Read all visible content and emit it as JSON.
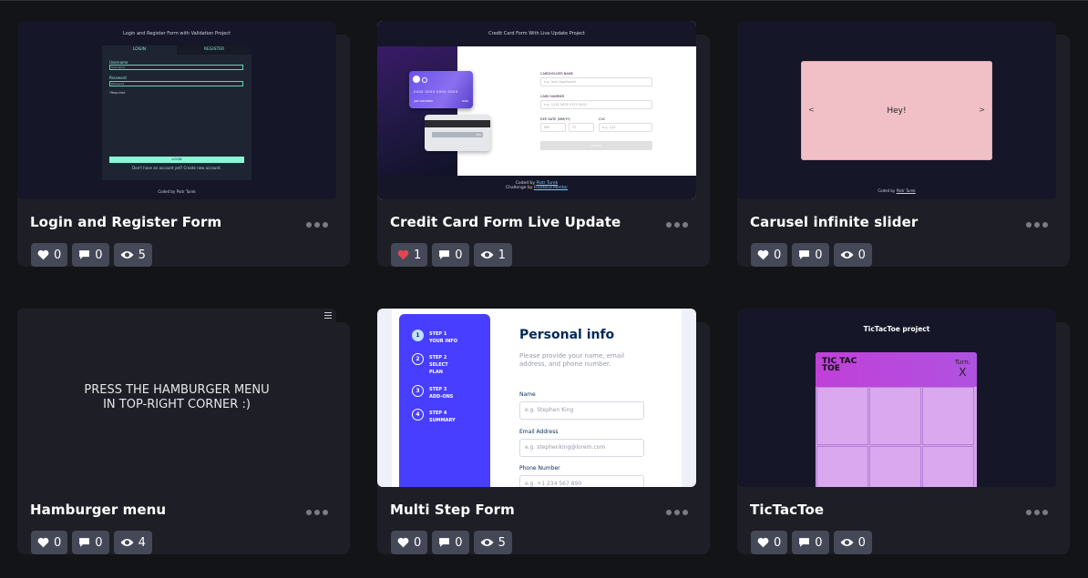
{
  "cards": [
    {
      "title": "Login and Register Form",
      "likes": "0",
      "comments": "0",
      "views": "5",
      "liked": false,
      "preview": {
        "heading": "Login and Register Form with Validation Project",
        "tab_login": "LOGIN",
        "tab_register": "REGISTER",
        "username_label": "Username",
        "username_placeholder": "Username",
        "password_label": "Password",
        "password_placeholder": "Password",
        "required": "*Required",
        "login_button": "LOGIN",
        "footer": "Don't have an account yet? Create new account.",
        "coded_by": "Coded by Piotr Turek"
      }
    },
    {
      "title": "Credit Card Form Live Update",
      "likes": "1",
      "comments": "0",
      "views": "1",
      "liked": true,
      "preview": {
        "heading": "Credit Card Form With Live Update Project",
        "card_number": "0000 0000 0000 0000",
        "card_name": "JANE APPLESEED",
        "card_exp": "00/00",
        "card_cvc": "000",
        "name_label": "CARDHOLDER NAME",
        "name_placeholder": "e.g. Jane Appleseed",
        "number_label": "CARD NUMBER",
        "number_placeholder": "e.g. 1234 5678 9123 0000",
        "exp_label": "EXP. DATE (MM/YY)",
        "mm_placeholder": "MM",
        "yy_placeholder": "YY",
        "cvc_label": "CVC",
        "cvc_placeholder": "e.g. 123",
        "confirm": "Confirm",
        "coded_prefix": "Coded by ",
        "coded_name": "Piotr Turek",
        "challenge_prefix": "Challenge by ",
        "challenge_name": "Frontend Mentor"
      }
    },
    {
      "title": "Carusel infinite slider",
      "likes": "0",
      "comments": "0",
      "views": "0",
      "liked": false,
      "preview": {
        "slide_text": "Hey!",
        "prev": "<",
        "next": ">",
        "coded_prefix": "Coded by ",
        "coded_name": "Piotr Turek"
      }
    },
    {
      "title": "Hamburger menu",
      "likes": "0",
      "comments": "0",
      "views": "4",
      "liked": false,
      "preview": {
        "line1": "PRESS THE HAMBURGER MENU",
        "line2": "IN TOP-RIGHT CORNER :)"
      }
    },
    {
      "title": "Multi Step Form",
      "likes": "0",
      "comments": "0",
      "views": "5",
      "liked": false,
      "preview": {
        "steps": [
          {
            "num": "1",
            "label": "STEP 1",
            "name": "YOUR INFO"
          },
          {
            "num": "2",
            "label": "STEP 2",
            "name": "SELECT PLAN"
          },
          {
            "num": "3",
            "label": "STEP 3",
            "name": "ADD-ONS"
          },
          {
            "num": "4",
            "label": "STEP 4",
            "name": "SUMMARY"
          }
        ],
        "heading": "Personal info",
        "subheading": "Please provide your name, email address, and phone number.",
        "name_label": "Name",
        "name_placeholder": "e.g. Stephen King",
        "email_label": "Email Address",
        "email_placeholder": "e.g. stephenking@lorem.com",
        "phone_label": "Phone Number",
        "phone_placeholder": "e.g. +1 234 567 890"
      }
    },
    {
      "title": "TicTacToe",
      "likes": "0",
      "comments": "0",
      "views": "0",
      "liked": false,
      "preview": {
        "heading": "TicTacToe project",
        "logo": "TIC TAC TOE",
        "turn_label": "Turn:",
        "turn_value": "X"
      }
    }
  ],
  "icons": {
    "like": "heart-icon",
    "comment": "comment-icon",
    "view": "eye-icon",
    "more": "more-dots-icon",
    "menu": "hamburger-icon"
  },
  "colors": {
    "page_bg": "#131417",
    "card_bg": "#1e1f26",
    "stat_bg": "#444857",
    "liked_heart": "#e2464e"
  }
}
